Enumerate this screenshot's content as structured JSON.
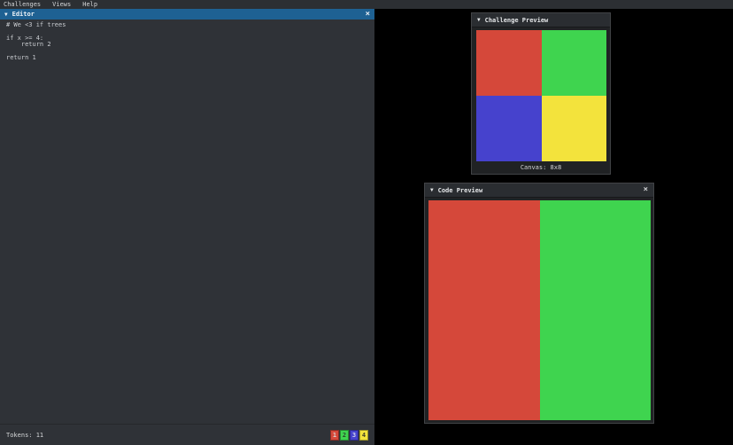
{
  "menubar": {
    "items": [
      {
        "label": "Challenges"
      },
      {
        "label": "Views"
      },
      {
        "label": "Help"
      }
    ]
  },
  "editor": {
    "collapse_icon": "▼",
    "title": "Editor",
    "close_icon": "×",
    "code_lines": [
      "# We <3 if trees",
      "",
      "if x >= 4:",
      "    return 2",
      "",
      "return 1"
    ],
    "tokens_label": "Tokens: 11",
    "token_chips": [
      {
        "label": "1",
        "color": "#d5483a",
        "text_color": "#d8cfcd"
      },
      {
        "label": "2",
        "color": "#3fd44f",
        "text_color": "#2c3f2c"
      },
      {
        "label": "3",
        "color": "#4642cd",
        "text_color": "#ced0ea"
      },
      {
        "label": "4",
        "color": "#f3e33c",
        "text_color": "#3c3a26"
      }
    ]
  },
  "challenge_preview": {
    "collapse_icon": "▼",
    "title": "Challenge Preview",
    "canvas_label": "Canvas: 8x8",
    "grid_colors": [
      [
        "#d5483a",
        "#3fd44f"
      ],
      [
        "#4642cd",
        "#f3e33c"
      ]
    ]
  },
  "code_preview": {
    "collapse_icon": "▼",
    "title": "Code Preview",
    "close_icon": "×",
    "column_colors": [
      "#d5483a",
      "#3fd44f"
    ]
  }
}
